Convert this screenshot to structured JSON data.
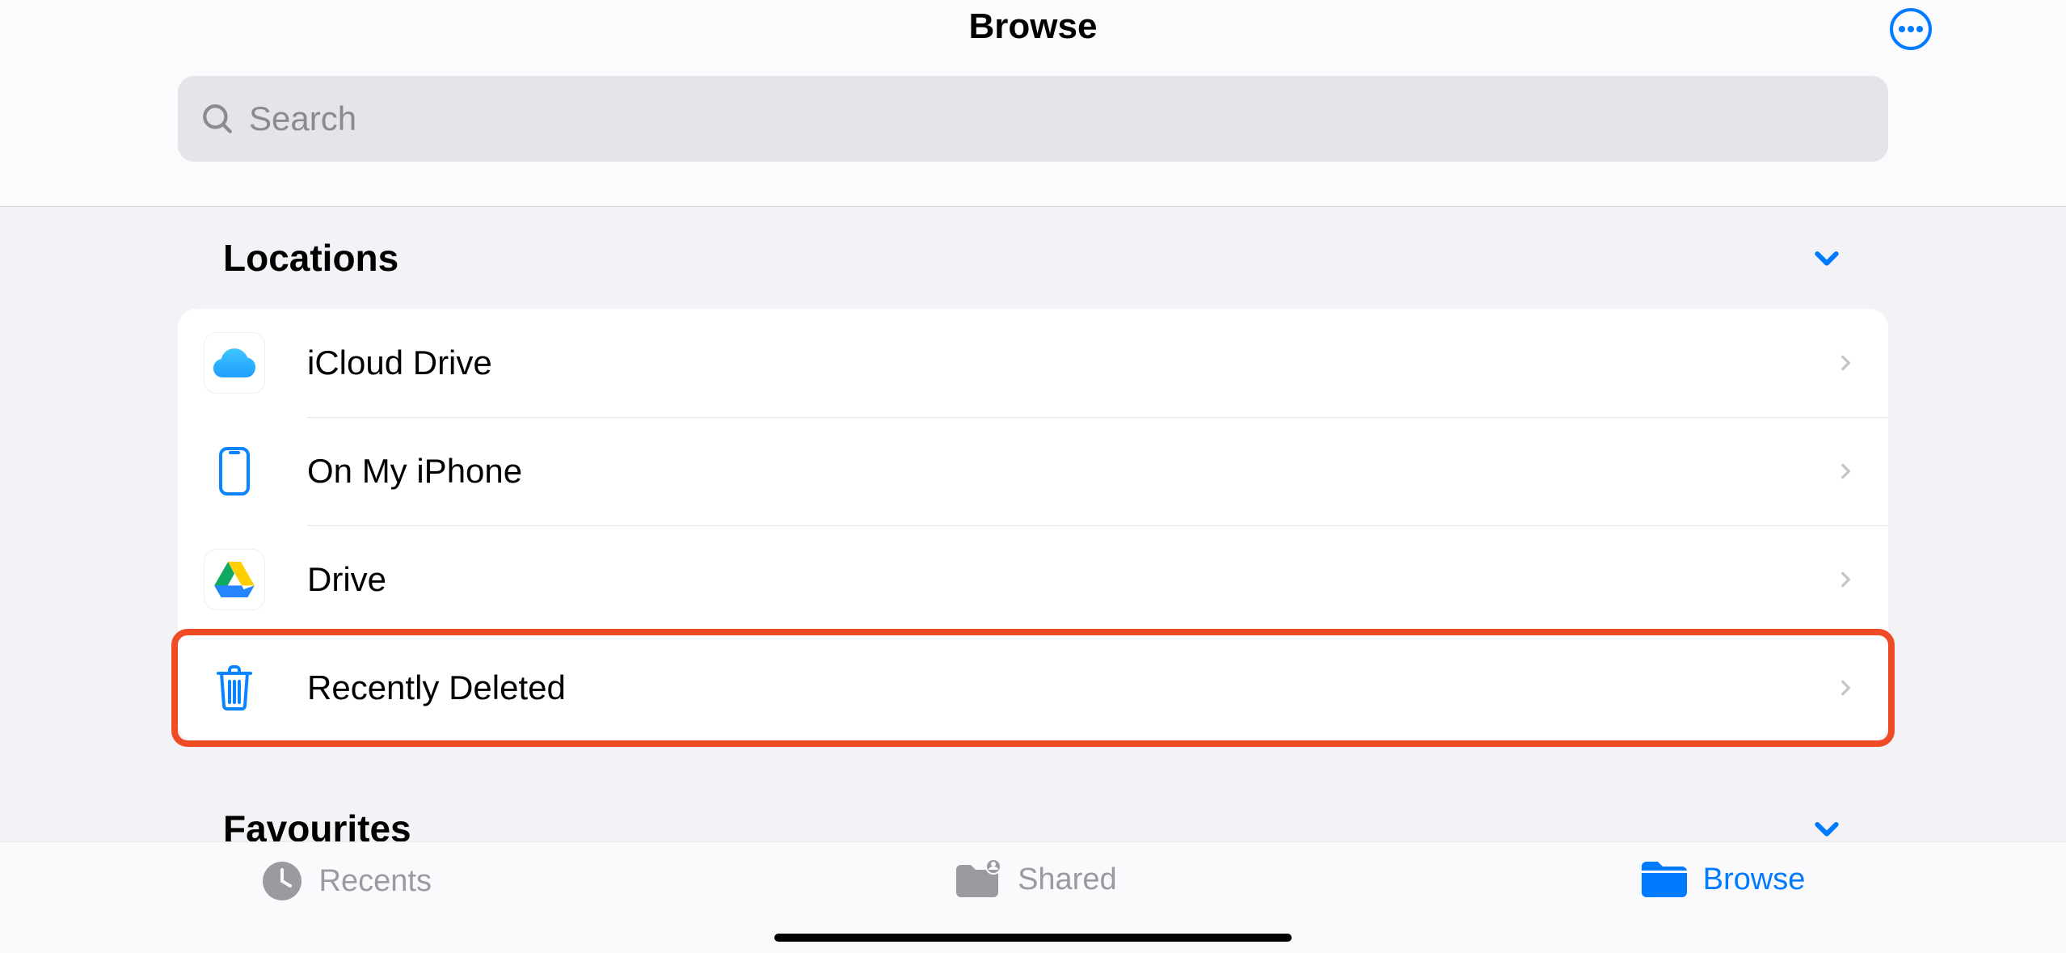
{
  "header": {
    "title": "Browse",
    "more_button_name": "more-options"
  },
  "search": {
    "placeholder": "Search",
    "value": ""
  },
  "sections": {
    "locations": {
      "title": "Locations",
      "expanded": true,
      "items": [
        {
          "icon": "icloud",
          "label": "iCloud Drive"
        },
        {
          "icon": "iphone",
          "label": "On My iPhone"
        },
        {
          "icon": "gdrive",
          "label": "Drive"
        },
        {
          "icon": "trash",
          "label": "Recently Deleted",
          "highlighted": true
        }
      ]
    },
    "favourites": {
      "title": "Favourites",
      "expanded": true
    }
  },
  "tabs": [
    {
      "icon": "clock",
      "label": "Recents",
      "active": false
    },
    {
      "icon": "folder-badge",
      "label": "Shared",
      "active": false
    },
    {
      "icon": "folder",
      "label": "Browse",
      "active": true
    }
  ],
  "colors": {
    "accent": "#007aff",
    "highlight_ring": "#ef4b24",
    "inactive": "#9a9aa0"
  }
}
